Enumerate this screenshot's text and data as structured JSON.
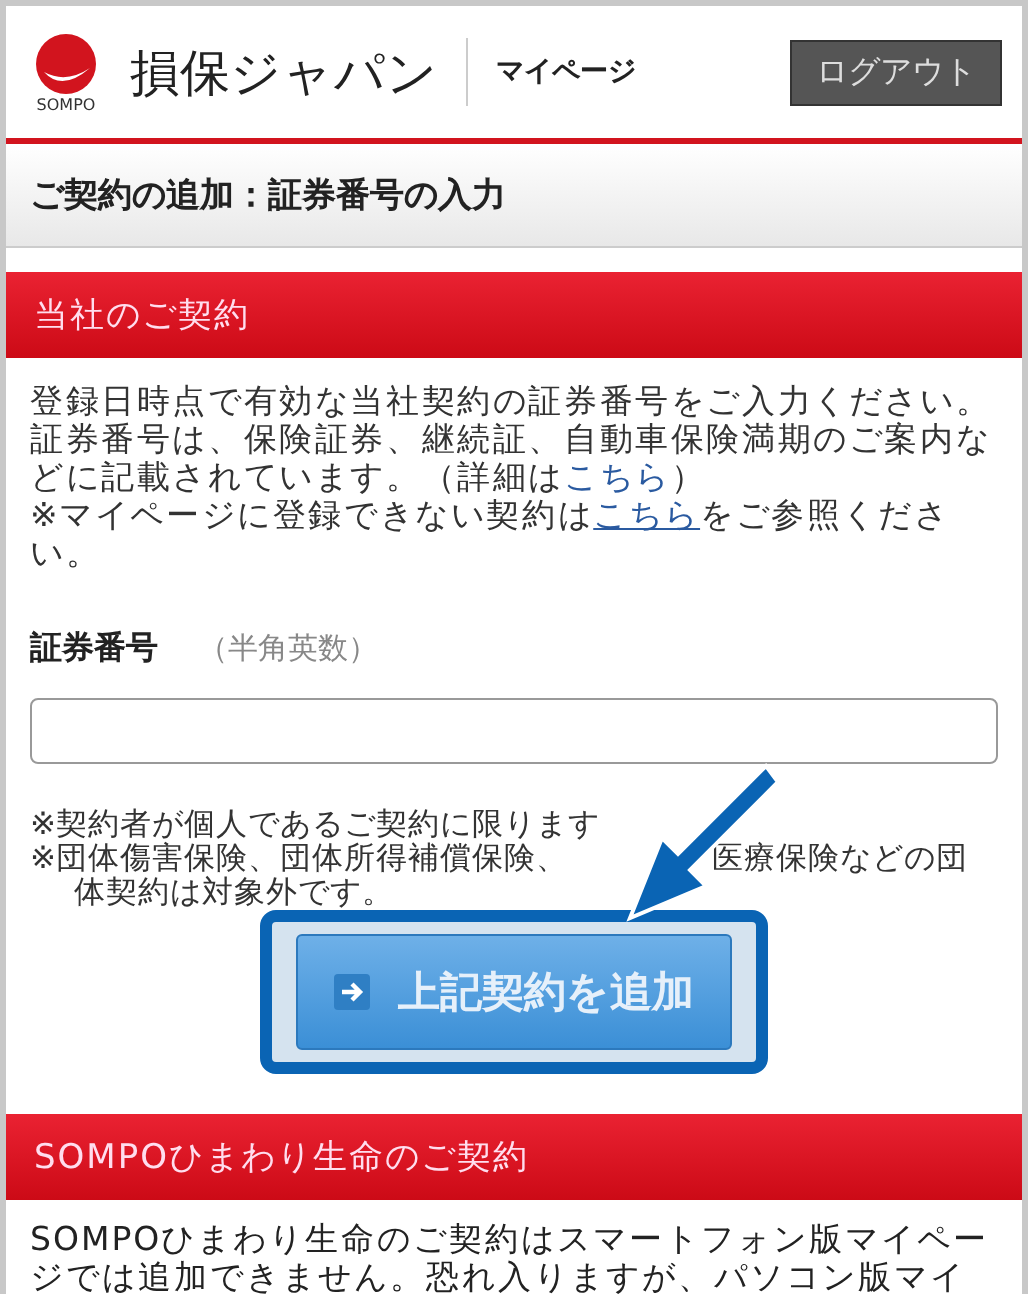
{
  "header": {
    "logo_caption": "SOMPO",
    "brand": "損保ジャパン",
    "section": "マイページ",
    "logout_button": "ログアウト"
  },
  "page_title": "ご契約の追加：証券番号の入力",
  "sections": [
    {
      "heading": "当社のご契約",
      "intro": {
        "text": "登録日時点で有効な当社契約の証券番号をご入力ください。証券番号は、保険証券、継続証、自動車保険満期のご案内などに記載されています。（詳細は",
        "link": "こちら",
        "tail": "）"
      },
      "note": {
        "text": "※マイページに登録できない契約は",
        "link": "こちら",
        "tail": "をご参照ください。"
      },
      "field": {
        "label": "証券番号",
        "hint": "（半角英数）"
      },
      "notes": [
        "※契約者が個人であるご契約に限ります",
        "※団体傷害保険、団体所得補償保険、",
        "医療保険などの団",
        "体契約は対象外です。"
      ],
      "button": "上記契約を追加"
    },
    {
      "heading": "SOMPOひまわり生命のご契約",
      "body": "SOMPOひまわり生命のご契約はスマートフォン版マイページでは追加できません。恐れ入りますが、パソコン版マイ"
    }
  ]
}
